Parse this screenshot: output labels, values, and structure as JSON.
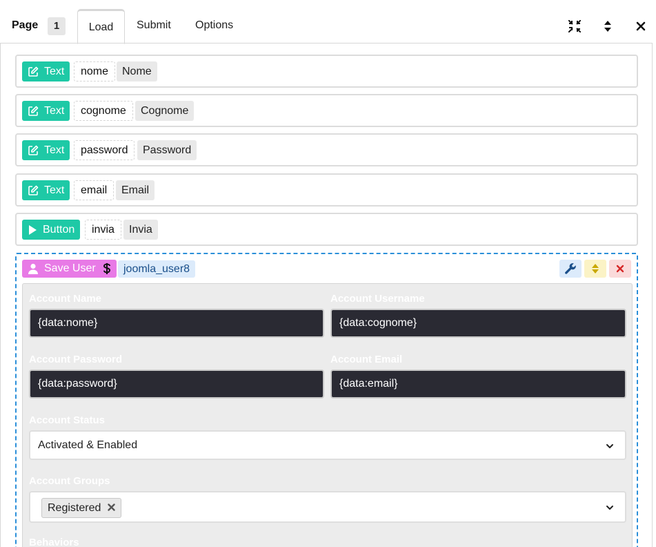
{
  "header": {
    "page_label": "Page",
    "page_number": "1",
    "tabs": [
      {
        "label": "Load",
        "active": true
      },
      {
        "label": "Submit",
        "active": false
      },
      {
        "label": "Options",
        "active": false
      }
    ],
    "icons": [
      "compress-icon",
      "sort-icon",
      "close-icon"
    ]
  },
  "fields": [
    {
      "type": "Text",
      "name": "nome",
      "label": "Nome",
      "icon": "edit-icon"
    },
    {
      "type": "Text",
      "name": "cognome",
      "label": "Cognome",
      "icon": "edit-icon"
    },
    {
      "type": "Text",
      "name": "password",
      "label": "Password",
      "icon": "edit-icon"
    },
    {
      "type": "Text",
      "name": "email",
      "label": "Email",
      "icon": "edit-icon"
    },
    {
      "type": "Button",
      "name": "invia",
      "label": "Invia",
      "icon": "play-icon"
    }
  ],
  "action": {
    "title": "Save User",
    "code": "joomla_user8",
    "icons": [
      "user-icon",
      "dollar-icon",
      "wrench-icon",
      "sort-icon",
      "close-icon"
    ],
    "colors": {
      "badge": "#e87ae6",
      "border": "#2b8fd9"
    },
    "settings": {
      "account_name_label": "Account Name",
      "account_name_value": "{data:nome}",
      "account_username_label": "Account Username",
      "account_username_value": "{data:cognome}",
      "account_password_label": "Account Password",
      "account_password_value": "{data:password}",
      "account_email_label": "Account Email",
      "account_email_value": "{data:email}",
      "account_status_label": "Account Status",
      "account_status_value": "Activated & Enabled",
      "account_groups_label": "Account Groups",
      "account_groups_tag": "Registered",
      "behaviors_label": "Behaviors"
    }
  },
  "colors": {
    "field_badge": "#1ec9a6"
  }
}
